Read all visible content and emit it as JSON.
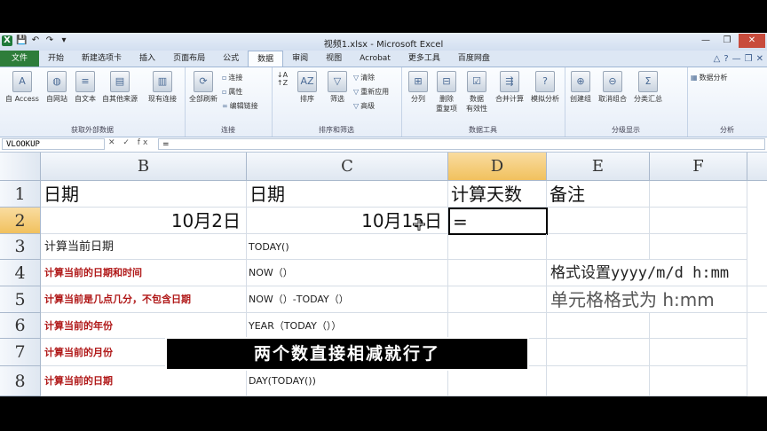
{
  "window": {
    "title": "视频1.xlsx - Microsoft Excel"
  },
  "tabs": [
    "文件",
    "开始",
    "新建选项卡",
    "插入",
    "页面布局",
    "公式",
    "数据",
    "审阅",
    "视图",
    "Acrobat",
    "更多工具",
    "百度网盘"
  ],
  "active_tab": "数据",
  "ribbon": {
    "groups": {
      "external": "获取外部数据",
      "connections": "连接",
      "sort_filter": "排序和筛选",
      "data_tools": "数据工具",
      "outline": "分级显示",
      "analysis": "分析"
    },
    "buttons": {
      "access": "自 Access",
      "web": "自网站",
      "text": "自文本",
      "other": "自其他来源",
      "existing": "现有连接",
      "refresh": "全部刷新",
      "conn": "连接",
      "props": "属性",
      "edit_links": "编辑链接",
      "sort": "排序",
      "filter": "筛选",
      "clear": "清除",
      "reapply": "重新应用",
      "advanced": "高级",
      "split": "分列",
      "remove_dup": "删除\n重复项",
      "validation": "数据\n有效性",
      "consolidate": "合并计算",
      "what_if": "模拟分析",
      "group": "创建组",
      "ungroup": "取消组合",
      "subtotal": "分类汇总",
      "data_analysis": "数据分析"
    }
  },
  "formula_bar": {
    "name_box": "VLOOKUP",
    "buttons": "✕ ✓ fx",
    "formula": "="
  },
  "columns": [
    "B",
    "C",
    "D",
    "E",
    "F"
  ],
  "rows": [
    "1",
    "2",
    "3",
    "4",
    "5",
    "6",
    "7",
    "8"
  ],
  "cells": {
    "B1": "日期",
    "C1": "日期",
    "D1": "计算天数",
    "E1": "备注",
    "B2": "10月2日",
    "C2": "10月15日",
    "D2": "=",
    "B3": "计算当前日期",
    "C3": "TODAY()",
    "B4": "计算当前的日期和时间",
    "C4": "NOW（）",
    "B5": "计算当前是几点几分，不包含日期",
    "C5": "NOW（）-TODAY（）",
    "B6": "计算当前的年份",
    "C6": "YEAR（TODAY（））",
    "B7": "计算当前的月份",
    "B8": "计算当前的日期",
    "C8": "DAY(TODAY())",
    "E4": "格式设置yyyy/m/d h:mm",
    "E5": "单元格格式为 h:mm"
  },
  "caption": "两个数直接相减就行了",
  "colors": {
    "file_tab": "#2e7d3a",
    "red_text": "#b01818",
    "selected_header": "#f1c15e"
  }
}
